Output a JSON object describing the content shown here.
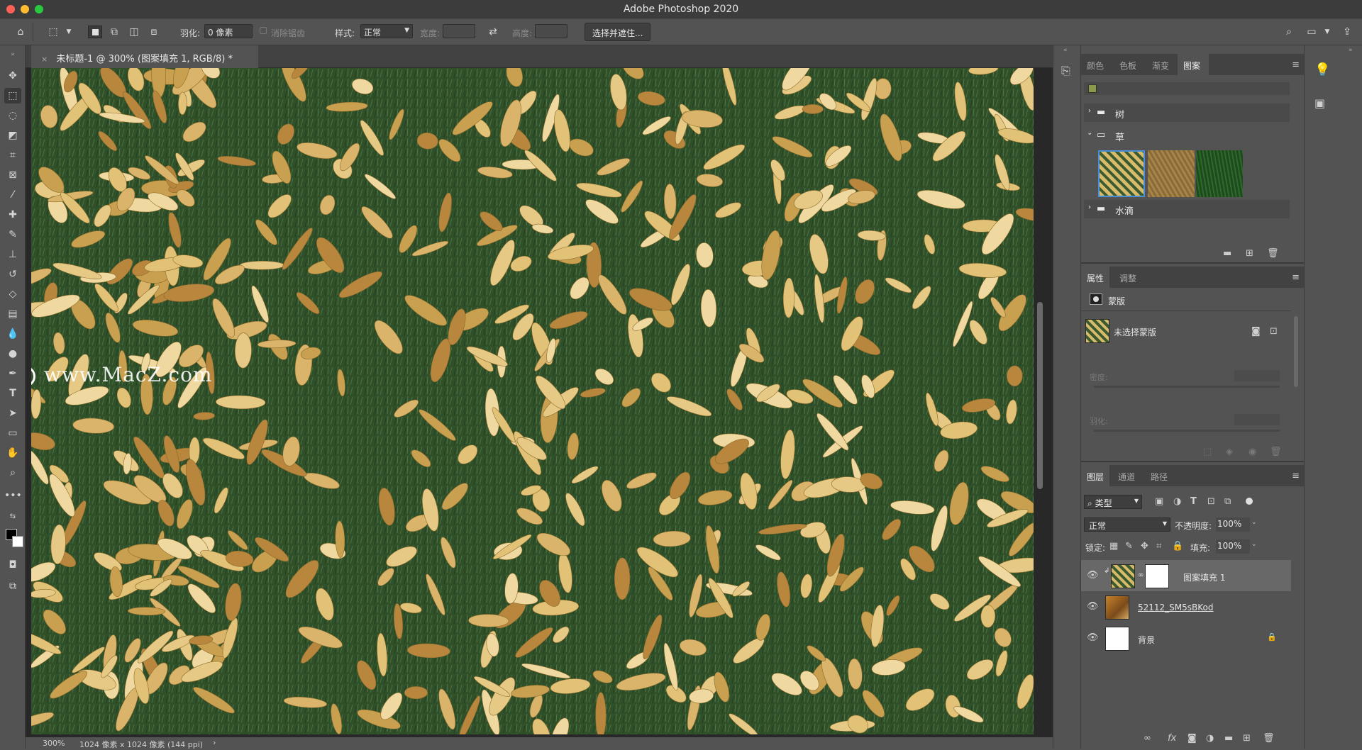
{
  "window": {
    "title": "Adobe Photoshop 2020"
  },
  "options_bar": {
    "feather_label": "羽化:",
    "feather_value": "0 像素",
    "antialias_label": "消除锯齿",
    "style_label": "样式:",
    "style_value": "正常",
    "width_label": "宽度:",
    "height_label": "高度:",
    "select_mask_button": "选择并遮住..."
  },
  "document": {
    "tab_title": "未标题-1 @ 300% (图案填充 1, RGB/8) *",
    "close_glyph": "×",
    "zoom": "300%",
    "info": "1024 像素 x 1024 像素 (144 ppi)"
  },
  "watermark": "www.MacZ.com",
  "patterns_panel": {
    "tabs": [
      "颜色",
      "色板",
      "渐变",
      "图案"
    ],
    "active_tab": "图案",
    "folders": [
      {
        "name": "树",
        "expanded": false
      },
      {
        "name": "草",
        "expanded": true
      },
      {
        "name": "水滴",
        "expanded": false
      }
    ],
    "swatches": [
      "leaves-on-grass",
      "dry-grass",
      "green-grass"
    ]
  },
  "properties_panel": {
    "tabs": [
      "属性",
      "调整"
    ],
    "active_tab": "属性",
    "section_label": "蒙版",
    "mask_status": "未选择蒙版",
    "density_label": "密度:",
    "feather_label": "羽化:"
  },
  "layers_panel": {
    "tabs": [
      "图层",
      "通道",
      "路径"
    ],
    "active_tab": "图层",
    "filter_label": "类型",
    "blend_mode": "正常",
    "opacity_label": "不透明度:",
    "opacity_value": "100%",
    "lock_label": "锁定:",
    "fill_label": "填充:",
    "fill_value": "100%",
    "layers": [
      {
        "name": "图案填充 1",
        "selected": true
      },
      {
        "name": "52112_SM5sBKod",
        "selected": false
      },
      {
        "name": "背景",
        "selected": false,
        "locked": true
      }
    ]
  },
  "colors": {
    "accent": "#4a8fd6",
    "panel_bg": "#535353",
    "canvas_grass": "#2f4d25",
    "leaf": "#e0c07a"
  }
}
